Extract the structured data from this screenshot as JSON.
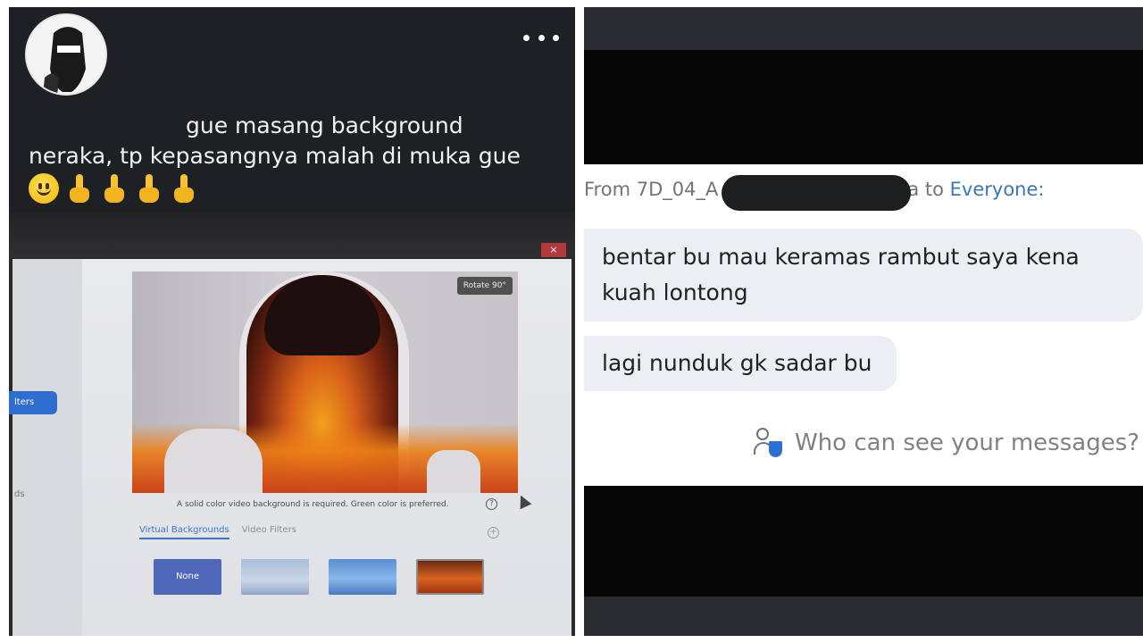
{
  "post": {
    "caption_line1": "gue masang background",
    "caption_line2": "neraka, tp kepasangnya malah di muka gue",
    "emoji": [
      "smile-emoji",
      "middle-finger-emoji",
      "middle-finger-emoji",
      "middle-finger-emoji",
      "middle-finger-emoji"
    ],
    "more_icon": "more-dots-icon"
  },
  "zoom_settings": {
    "filters_label": "lters",
    "side_label": "ds",
    "rotate_label": "Rotate 90°",
    "warning": "A solid color video background is required. Green color is preferred.",
    "tabs": [
      "Virtual Backgrounds",
      "Video Filters"
    ],
    "none_label": "None",
    "close_label": "×"
  },
  "chat": {
    "from_prefix": "From 7D_04_A",
    "from_suffix": "a to ",
    "to_label": "Everyone:",
    "message1": "bentar bu mau keramas rambut saya kena kuah lontong",
    "message2": "lagi nunduk gk sadar bu",
    "privacy_link": "Who can see your messages?"
  },
  "colors": {
    "accent_blue": "#3978b8",
    "bubble_bg": "#eceef3",
    "dark_bg": "#1e2024"
  }
}
